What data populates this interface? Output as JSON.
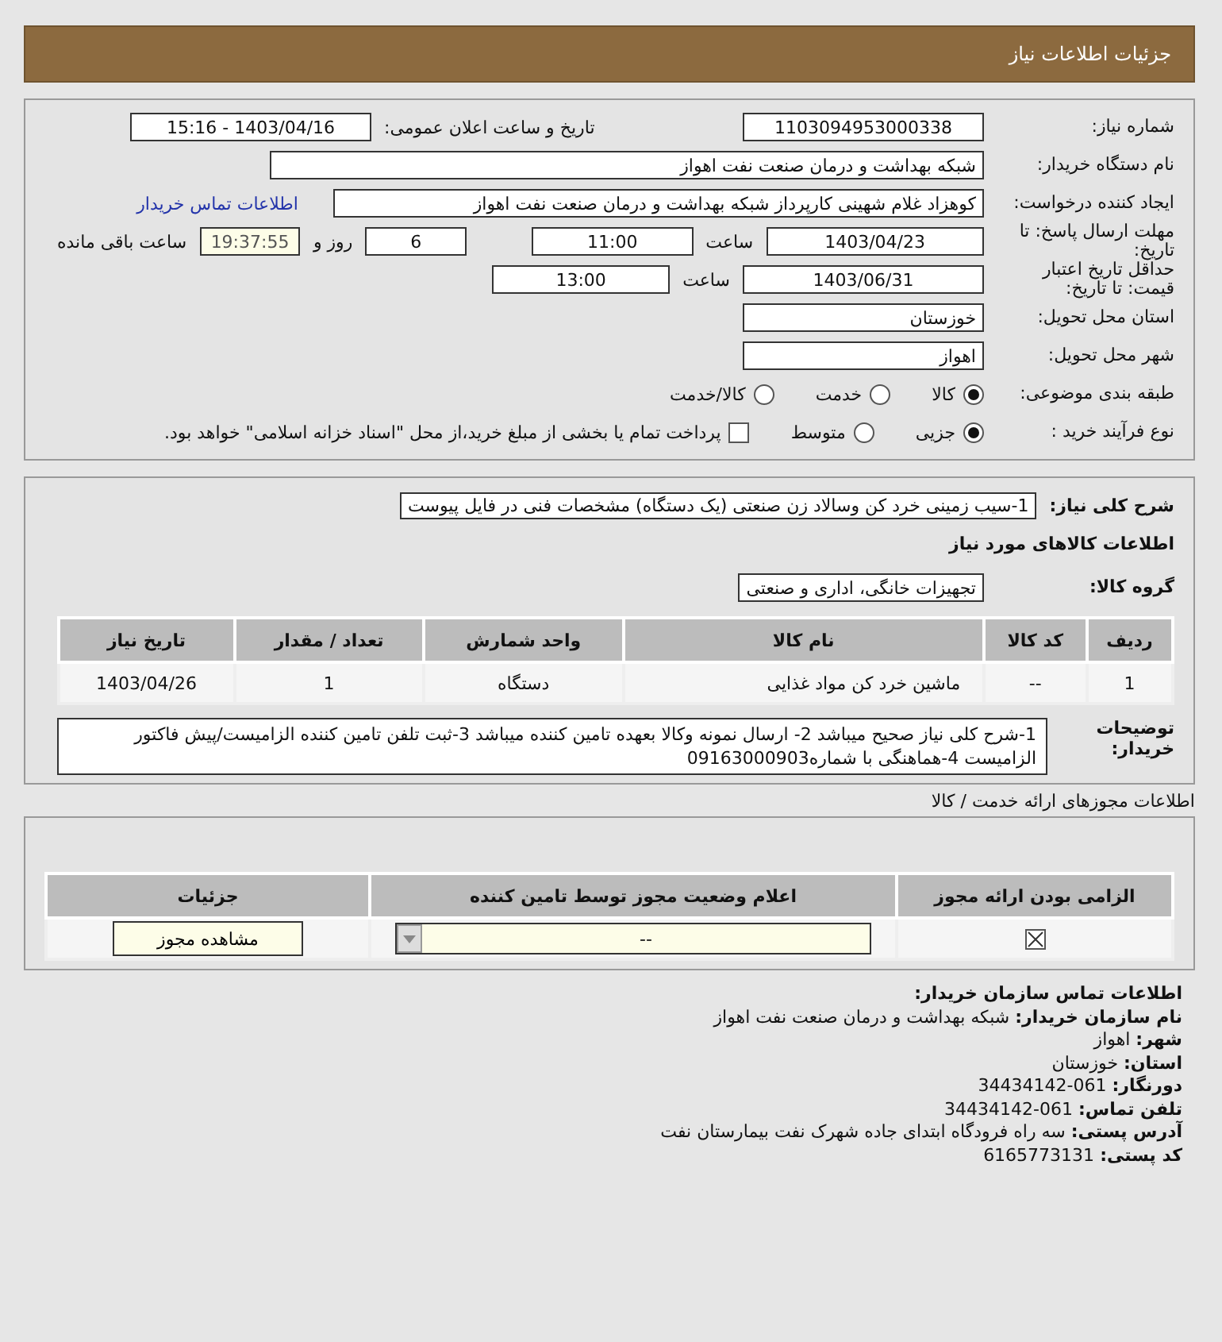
{
  "header": {
    "title": "جزئیات اطلاعات نیاز"
  },
  "need_number": {
    "label": "شماره نیاز:",
    "value": "1103094953000338"
  },
  "announce": {
    "label": "تاریخ و ساعت اعلان عمومی:",
    "value": "1403/04/16 - 15:16"
  },
  "buyer_org": {
    "label": "نام دستگاه خریدار:",
    "value": "شبکه بهداشت و درمان صنعت نفت اهواز"
  },
  "requester": {
    "label": "ایجاد کننده درخواست:",
    "value": "کوهزاد غلام شهینی کارپرداز شبکه بهداشت و درمان صنعت نفت اهواز",
    "link": "اطلاعات تماس خریدار"
  },
  "response_deadline": {
    "label": "مهلت ارسال پاسخ: تا تاریخ:",
    "date": "1403/04/23",
    "time_label": "ساعت",
    "time": "11:00",
    "days": "6",
    "days_label": "روز و",
    "remaining": "19:37:55",
    "remaining_label": "ساعت باقی مانده"
  },
  "price_validity": {
    "label": "حداقل تاریخ اعتبار قیمت: تا تاریخ:",
    "date": "1403/06/31",
    "time_label": "ساعت",
    "time": "13:00"
  },
  "province": {
    "label": "استان محل تحویل:",
    "value": "خوزستان"
  },
  "city": {
    "label": "شهر محل تحویل:",
    "value": "اهواز"
  },
  "category": {
    "label": "طبقه بندی موضوعی:",
    "options": [
      {
        "label": "کالا",
        "selected": true
      },
      {
        "label": "خدمت",
        "selected": false
      },
      {
        "label": "کالا/خدمت",
        "selected": false
      }
    ]
  },
  "process": {
    "label": "نوع فرآیند خرید :",
    "options": [
      {
        "label": "جزیی",
        "selected": true
      },
      {
        "label": "متوسط",
        "selected": false
      }
    ],
    "treasury": {
      "checked": false,
      "label": "پرداخت تمام یا بخشی از مبلغ خرید،از محل \"اسناد خزانه اسلامی\" خواهد بود."
    }
  },
  "summary": {
    "label": "شرح کلی نیاز:",
    "value": "1-سیب زمینی خرد کن وسالاد زن صنعتی (یک دستگاه) مشخصات فنی در فایل پیوست"
  },
  "goods_heading": "اطلاعات کالاهای مورد نیاز",
  "goods_group": {
    "label": "گروه کالا:",
    "value": "تجهیزات خانگی، اداری و صنعتی"
  },
  "goods_table": {
    "columns": [
      "ردیف",
      "کد کالا",
      "نام کالا",
      "واحد شمارش",
      "تعداد / مقدار",
      "تاریخ نیاز"
    ],
    "rows": [
      {
        "cells": [
          "1",
          "--",
          "ماشین خرد کن مواد غذایی",
          "دستگاه",
          "1",
          "1403/04/26"
        ]
      }
    ]
  },
  "buyer_notes": {
    "label": "توضیحات خریدار:",
    "value": "1-شرح کلی نیاز صحیح میباشد 2- ارسال نمونه وکالا بعهده تامین کننده میباشد 3-ثبت تلفن تامین کننده الزامیست/پیش فاکتور الزامیست 4-هماهنگی با شماره09163000903"
  },
  "license_heading": "اطلاعات مجوزهای ارائه خدمت / کالا",
  "license_table": {
    "columns": [
      "الزامی بودن ارائه مجوز",
      "اعلام وضعیت مجوز توسط تامین کننده",
      "جزئیات"
    ],
    "rows": [
      {
        "required": true,
        "status": "--",
        "button": "مشاهده مجوز"
      }
    ]
  },
  "contact": {
    "heading": "اطلاعات تماس سازمان خریدار:",
    "lines": [
      "**نام سازمان خریدار:** شبکه بهداشت و درمان صنعت نفت اهواز",
      "**شهر:** اهواز",
      "**استان:** خوزستان",
      "**دورنگار:** 061-34434142",
      "**تلفن تماس:** 061-34434142",
      "**آدرس پستی:** سه راه فرودگاه ابتدای جاده شهرک نفت بیمارستان نفت",
      "**کد پستی:** 6165773131"
    ]
  }
}
